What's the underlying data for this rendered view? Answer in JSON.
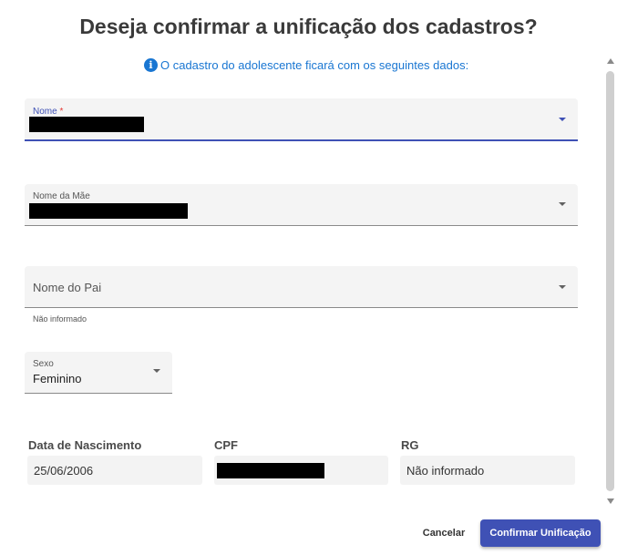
{
  "dialog": {
    "title": "Deseja confirmar a unificação dos cadastros?",
    "subtitle": "O cadastro do adolescente ficará com os seguintes dados:",
    "info_icon": "info-icon"
  },
  "fields": {
    "nome": {
      "label": "Nome",
      "required_mark": "*",
      "value_redacted": true
    },
    "nome_mae": {
      "label": "Nome da Mãe",
      "value_redacted": true
    },
    "nome_pai": {
      "placeholder": "Nome do Pai",
      "hint": "Não informado"
    },
    "sexo": {
      "label": "Sexo",
      "value": "Feminino"
    }
  },
  "readonly": {
    "data_nascimento": {
      "label": "Data de Nascimento",
      "value": "25/06/2006"
    },
    "cpf": {
      "label": "CPF",
      "value_redacted": true
    },
    "rg": {
      "label": "RG",
      "value": "Não informado"
    }
  },
  "actions": {
    "cancel_label": "Cancelar",
    "confirm_label": "Confirmar Unificação"
  },
  "colors": {
    "primary": "#3f51b5",
    "info": "#1976d2",
    "field_bg": "#f4f4f4"
  }
}
